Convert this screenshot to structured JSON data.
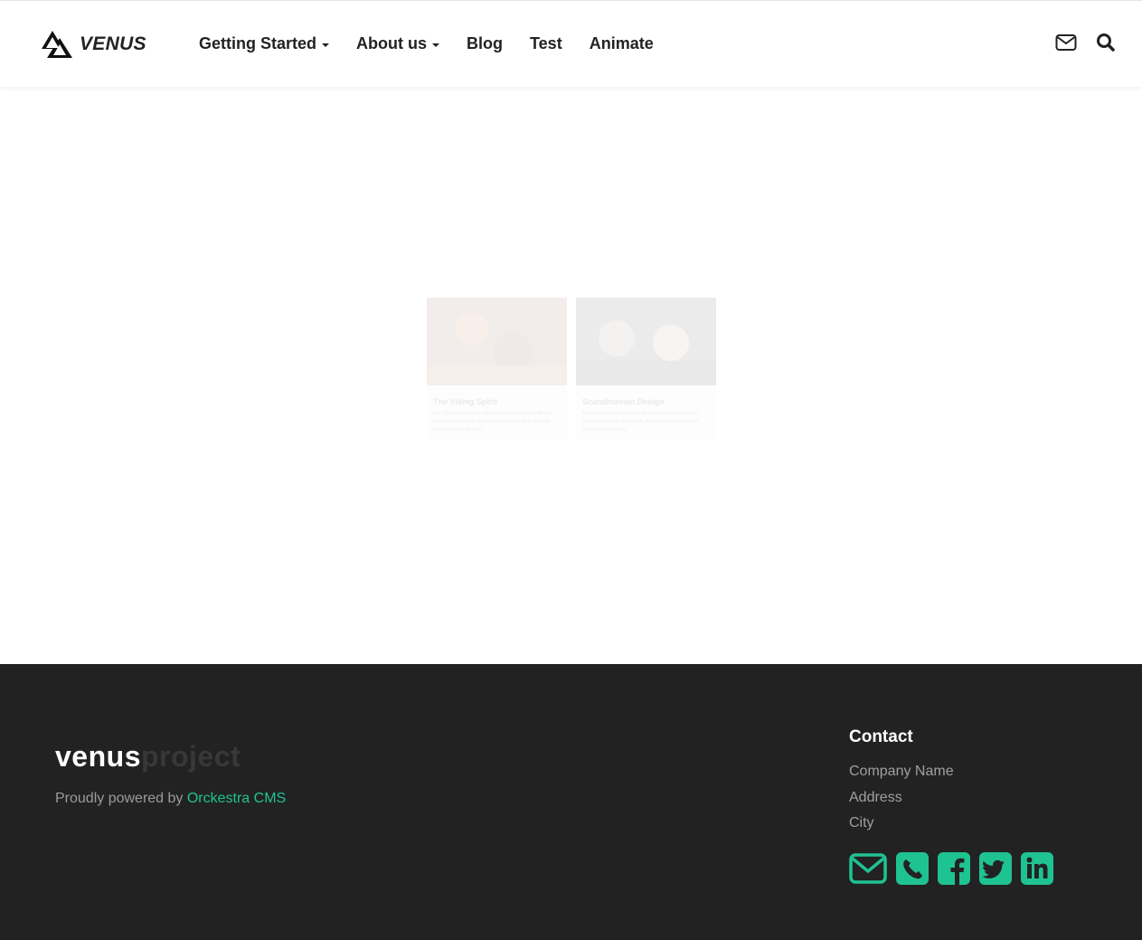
{
  "brand": {
    "name": "VENUS",
    "logo_icon": "venus-triangles-logo"
  },
  "nav": {
    "items": [
      {
        "label": "Getting Started",
        "dropdown": true
      },
      {
        "label": "About us",
        "dropdown": true
      },
      {
        "label": "Blog",
        "dropdown": false
      },
      {
        "label": "Test",
        "dropdown": false
      },
      {
        "label": "Animate",
        "dropdown": false
      }
    ],
    "icons": [
      "envelope-icon",
      "search-icon"
    ]
  },
  "cards": [
    {
      "title": "The Viking Spirit",
      "text": "Our CMS let you attract customers where it is most effective. Faster text and views with adverts to create perfection and customer views by hand."
    },
    {
      "title": "Scandinavian Design",
      "text": "The Scandinavian focus on both form and function can be traced through the architecture, the look and your ability to structure your website."
    }
  ],
  "footer": {
    "logo_bold": "venus",
    "logo_light": "project",
    "powered_prefix": "Proudly powered by ",
    "powered_link": "Orckestra CMS",
    "contact_title": "Contact",
    "contact_lines": [
      "Company Name",
      "Address",
      "City"
    ],
    "social_icons": [
      "envelope-icon",
      "phone-icon",
      "facebook-icon",
      "twitter-icon",
      "linkedin-icon"
    ],
    "accent_color": "#1fc391"
  }
}
